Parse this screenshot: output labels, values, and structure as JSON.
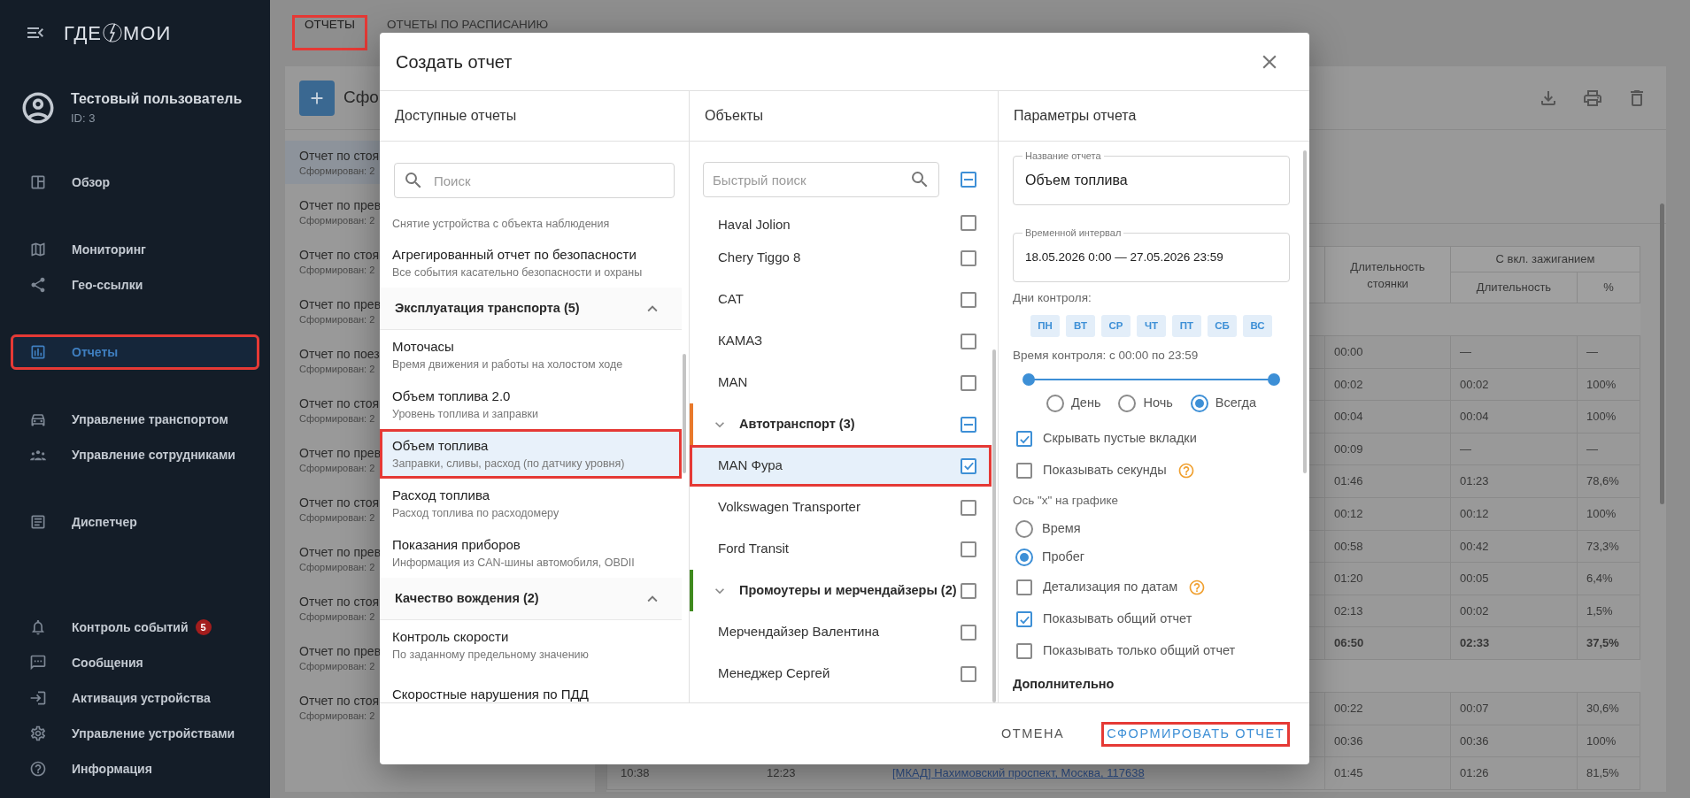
{
  "sidebar": {
    "logo": {
      "left": "ГДЕ",
      "right": "МОИ"
    },
    "user": {
      "name": "Тестовый пользователь",
      "id": "ID: 3"
    },
    "nav_groups": [
      {
        "items": [
          {
            "label": "Обзор",
            "selected": false,
            "highlighted": false
          }
        ]
      },
      {
        "items": [
          {
            "label": "Мониторинг",
            "selected": false,
            "highlighted": false
          },
          {
            "label": "Гео-ссылки",
            "selected": false,
            "highlighted": false
          }
        ]
      },
      {
        "items": [
          {
            "label": "Отчеты",
            "selected": true,
            "highlighted": true
          }
        ]
      },
      {
        "items": [
          {
            "label": "Управление транспортом",
            "selected": false,
            "highlighted": false
          },
          {
            "label": "Управление сотрудниками",
            "selected": false,
            "highlighted": false
          }
        ]
      },
      {
        "items": [
          {
            "label": "Диспетчер",
            "selected": false,
            "highlighted": false
          }
        ]
      }
    ],
    "bottom_items": [
      {
        "label": "Контроль событий",
        "badge": "5",
        "selected": false
      },
      {
        "label": "Сообщения",
        "selected": false
      },
      {
        "label": "Активация устройства",
        "selected": false
      },
      {
        "label": "Управление устройствами",
        "selected": false
      },
      {
        "label": "Информация",
        "selected": false
      }
    ]
  },
  "tabs": [
    {
      "label": "ОТЧЕТЫ",
      "selected": true,
      "highlighted": true
    },
    {
      "label": "ОТЧЕТЫ ПО РАСПИСАНИЮ",
      "selected": false,
      "highlighted": false
    }
  ],
  "page": {
    "title": "Сфо",
    "report_list": [
      {
        "title": "Отчет по стоя",
        "subtitle": "Сформирован: 2",
        "selected": true
      },
      {
        "title": "Отчет по прев",
        "subtitle": "Сформирован: 2",
        "selected": false
      },
      {
        "title": "Отчет по стоя",
        "subtitle": "Сформирован: 2",
        "selected": false
      },
      {
        "title": "Отчет по прев",
        "subtitle": "Сформирован: 2",
        "selected": false
      },
      {
        "title": "Отчет по поез",
        "subtitle": "Сформирован: 2",
        "selected": false
      },
      {
        "title": "Отчет по стоя",
        "subtitle": "Сформирован: 2",
        "selected": false
      },
      {
        "title": "Отчет по прев",
        "subtitle": "Сформирован: 2",
        "selected": false
      },
      {
        "title": "Отчет по стоя",
        "subtitle": "Сформирован: 2",
        "selected": false
      },
      {
        "title": "Отчет по прев",
        "subtitle": "Сформирован: 2",
        "selected": false
      },
      {
        "title": "Отчет по стоя",
        "subtitle": "Сформирован: 2",
        "selected": false
      },
      {
        "title": "Отчет по прев",
        "subtitle": "Сформирован: 2",
        "selected": false
      },
      {
        "title": "Отчет по стоя",
        "subtitle": "Сформирован: 2",
        "selected": false
      }
    ],
    "table": {
      "columns": [
        {
          "label": "Длительность стоянки"
        },
        {
          "label": "С вкл. зажиганием",
          "children": [
            "Длительность",
            "%"
          ]
        }
      ],
      "rows": [
        {
          "kind": "group"
        },
        {
          "kind": "data",
          "cells": [
            "00:00",
            "—",
            "—"
          ]
        },
        {
          "kind": "data",
          "cells": [
            "00:02",
            "00:02",
            "100%"
          ]
        },
        {
          "kind": "data",
          "cells": [
            "00:04",
            "00:04",
            "100%"
          ]
        },
        {
          "kind": "data",
          "cells": [
            "00:09",
            "—",
            "—"
          ]
        },
        {
          "kind": "data",
          "cells": [
            "01:46",
            "01:23",
            "78,6%"
          ]
        },
        {
          "kind": "data",
          "cells": [
            "00:12",
            "00:12",
            "100%"
          ]
        },
        {
          "kind": "data",
          "cells": [
            "00:58",
            "00:42",
            "73,3%"
          ]
        },
        {
          "kind": "data",
          "cells": [
            "01:20",
            "00:05",
            "6,4%"
          ]
        },
        {
          "kind": "data",
          "cells": [
            "02:13",
            "00:02",
            "1,5%"
          ]
        },
        {
          "kind": "total",
          "cells": [
            "06:50",
            "02:33",
            "37,5%"
          ]
        },
        {
          "kind": "group"
        },
        {
          "kind": "data",
          "cells": [
            "00:22",
            "00:07",
            "30,6%"
          ]
        },
        {
          "kind": "data",
          "cells": [
            "00:36",
            "00:36",
            "100%"
          ]
        },
        {
          "kind": "data",
          "left_cells": [
            "10:38",
            "12:23"
          ],
          "link": "[МКАД] Нахимовский проспект, Москва, 117638",
          "cells": [
            "01:45",
            "01:26",
            "81,5%"
          ]
        }
      ]
    }
  },
  "dialog": {
    "title": "Создать отчет",
    "reports": {
      "heading": "Доступные отчеты",
      "search_placeholder": "Поиск",
      "items": [
        {
          "kind": "report",
          "subtitle": "Снятие устройства с объекта наблюдения",
          "selected": false,
          "highlighted": false
        },
        {
          "kind": "report",
          "title": "Агрегированный отчет по безопасности",
          "subtitle": "Все события касательно безопасности и охраны",
          "selected": false,
          "highlighted": false
        },
        {
          "kind": "section",
          "title": "Эксплуатация транспорта (5)",
          "expanded": true
        },
        {
          "kind": "report",
          "title": "Моточасы",
          "subtitle": "Время движения и работы на холостом ходе",
          "selected": false,
          "highlighted": false
        },
        {
          "kind": "report",
          "title": "Объем топлива 2.0",
          "subtitle": "Уровень топлива и заправки",
          "selected": false,
          "highlighted": false
        },
        {
          "kind": "report",
          "title": "Объем топлива",
          "subtitle": "Заправки, сливы, расход (по датчику уровня)",
          "selected": true,
          "highlighted": true
        },
        {
          "kind": "report",
          "title": "Расход топлива",
          "subtitle": "Расход топлива по расходомеру",
          "selected": false,
          "highlighted": false
        },
        {
          "kind": "report",
          "title": "Показания приборов",
          "subtitle": "Информация из CAN-шины автомобиля, OBDII",
          "selected": false,
          "highlighted": false
        },
        {
          "kind": "section",
          "title": "Качество вождения (2)",
          "expanded": true
        },
        {
          "kind": "report",
          "title": "Контроль скорости",
          "subtitle": "По заданному предельному значению",
          "selected": false,
          "highlighted": false
        },
        {
          "kind": "report",
          "title": "Скоростные нарушения по ПДД",
          "selected": false,
          "highlighted": false
        }
      ]
    },
    "objects": {
      "heading": "Объекты",
      "search_placeholder": "Быстрый поиск",
      "all_indeterminate": true,
      "items": [
        {
          "kind": "object",
          "label": "Haval Jolion",
          "checked": false,
          "selected": false,
          "highlighted": false
        },
        {
          "kind": "object",
          "label": "Chery Tiggo 8",
          "checked": false,
          "selected": false,
          "highlighted": false
        },
        {
          "kind": "object",
          "label": "CAT",
          "checked": false,
          "selected": false,
          "highlighted": false
        },
        {
          "kind": "object",
          "label": "КАМАЗ",
          "checked": false,
          "selected": false,
          "highlighted": false
        },
        {
          "kind": "object",
          "label": "MAN",
          "checked": false,
          "selected": false,
          "highlighted": false
        },
        {
          "kind": "group",
          "label": "Автотранспорт (3)",
          "color": "#e8792b",
          "expanded": true,
          "checked": false,
          "indeterminate": true
        },
        {
          "kind": "object",
          "label": "MAN Фура",
          "checked": true,
          "selected": true,
          "highlighted": true
        },
        {
          "kind": "object",
          "label": "Volkswagen Transporter",
          "checked": false,
          "selected": false,
          "highlighted": false
        },
        {
          "kind": "object",
          "label": "Ford Transit",
          "checked": false,
          "selected": false,
          "highlighted": false
        },
        {
          "kind": "group",
          "label": "Промоутеры и мерчендайзеры (2)",
          "color": "#3f8a1e",
          "expanded": true,
          "checked": false,
          "indeterminate": false
        },
        {
          "kind": "object",
          "label": "Мерчендайзер Валентина",
          "checked": false,
          "selected": false,
          "highlighted": false
        },
        {
          "kind": "object",
          "label": "Менеджер Сергей",
          "checked": false,
          "selected": false,
          "highlighted": false
        }
      ]
    },
    "params": {
      "heading": "Параметры отчета",
      "name_field": {
        "label": "Название отчета",
        "value": "Объем топлива"
      },
      "interval_field": {
        "label": "Временной интервал",
        "value": "18.05.2026 0:00 — 27.05.2026 23:59"
      },
      "days_label": "Дни контроля:",
      "days": [
        {
          "label": "ПН",
          "selected": true
        },
        {
          "label": "ВТ",
          "selected": true
        },
        {
          "label": "СР",
          "selected": true
        },
        {
          "label": "ЧТ",
          "selected": true
        },
        {
          "label": "ПТ",
          "selected": true
        },
        {
          "label": "СБ",
          "selected": true
        },
        {
          "label": "ВС",
          "selected": true
        }
      ],
      "time_label": "Время контроля: с 00:00 по 23:59",
      "time_slider": {
        "thumbs": [
          {
            "level": 0
          },
          {
            "level": 1
          }
        ]
      },
      "period_options": [
        {
          "label": "День",
          "selected": false
        },
        {
          "label": "Ночь",
          "selected": false
        },
        {
          "label": "Всегда",
          "selected": true
        }
      ],
      "options": [
        {
          "kind": "checkbox",
          "label": "Скрывать пустые вкладки",
          "checked": true,
          "help": false
        },
        {
          "kind": "checkbox",
          "label": "Показывать секунды",
          "checked": false,
          "help": true
        },
        {
          "kind": "heading",
          "label": "Ось \"x\" на графике"
        },
        {
          "kind": "radio",
          "label": "Время",
          "selected": false
        },
        {
          "kind": "radio",
          "label": "Пробег",
          "selected": true
        },
        {
          "kind": "checkbox",
          "label": "Детализация по датам",
          "checked": false,
          "help": true
        },
        {
          "kind": "checkbox",
          "label": "Показывать общий отчет",
          "checked": true,
          "help": false
        },
        {
          "kind": "checkbox",
          "label": "Показывать только общий отчет",
          "checked": false,
          "help": false
        },
        {
          "kind": "section",
          "label": "Дополнительно"
        }
      ]
    },
    "buttons": [
      {
        "label": "ОТМЕНА",
        "kind": "text",
        "highlighted": false
      },
      {
        "label": "СФОРМИРОВАТЬ ОТЧЕТ",
        "kind": "primary",
        "highlighted": true
      }
    ]
  }
}
